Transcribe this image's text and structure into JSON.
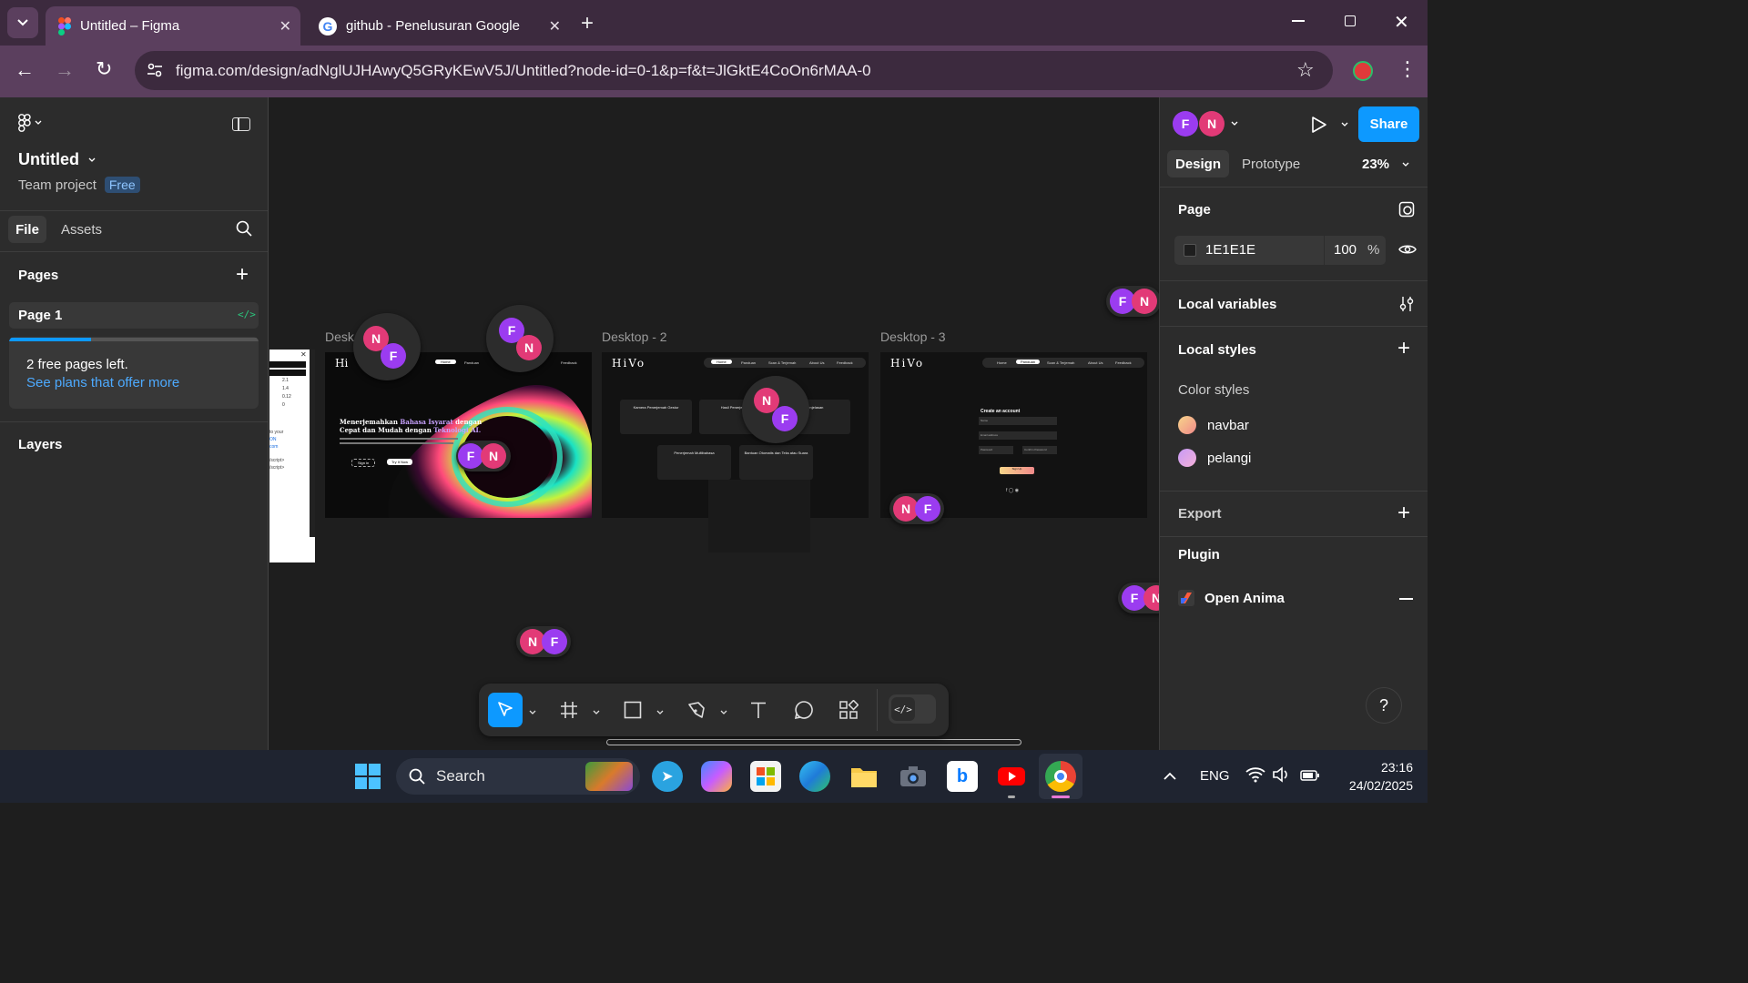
{
  "browser": {
    "tabs": [
      {
        "title": "Untitled – Figma",
        "active": true,
        "icon": "figma-logo-icon"
      },
      {
        "title": "github - Penelusuran Google",
        "active": false,
        "icon": "google-logo-icon"
      }
    ],
    "url": "figma.com/design/adNglUJHAwyQ5GRyKEwV5J/Untitled?node-id=0-1&p=f&t=JlGktE4CoOn6rMAA-0"
  },
  "left_panel": {
    "file_name": "Untitled",
    "project": "Team project",
    "plan_badge": "Free",
    "tabs": {
      "file": "File",
      "assets": "Assets"
    },
    "pages_title": "Pages",
    "current_page": "Page 1",
    "free_pages_notice": "2 free pages left.",
    "plans_link": "See plans that offer more",
    "free_pages_progress": 0.33,
    "layers_title": "Layers"
  },
  "canvas": {
    "frames": [
      {
        "label": "Desktop - 1",
        "label_visible": "Desk"
      },
      {
        "label": "Desktop - 2"
      },
      {
        "label": "Desktop - 3"
      }
    ],
    "frame1": {
      "logo": "Hi",
      "nav": [
        "Home",
        "Panduan",
        "Feedback"
      ],
      "headline_1": "Menerjemahkan",
      "headline_highlight": "Bahasa Isyarat",
      "headline_2": "dengan",
      "headline_3": "Cepat dan Mudah dengan",
      "headline_highlight_2": "Teknologi AI.",
      "btn_signin": "Sign in",
      "btn_tryit": "Try It Now"
    },
    "frame2": {
      "logo": "HiVo",
      "nav": [
        "Home",
        "Panduan",
        "Scan & Terjemah",
        "About Us",
        "Feedback"
      ],
      "cards": [
        "Kamera Penerjemah Gestur",
        "Hasil Penerjemah",
        "Penjelasan",
        "Penerjemah Multibahasa",
        "Bantuan Otomatis dan Teks atau Suara"
      ]
    },
    "frame3": {
      "logo": "HiVo",
      "nav": [
        "Home",
        "Panduan",
        "Scan & Terjemah",
        "About Us",
        "Feedback"
      ],
      "form_title": "Create an account",
      "fields": [
        "Name",
        "Email address",
        "Password",
        "Confirm Password"
      ],
      "btn": "Sign Up"
    },
    "partial_window": {
      "numbers": [
        "2.1",
        "1.4",
        "0.12",
        "0"
      ],
      "code_lines": [
        "to your",
        "ON",
        "com",
        "/script>",
        "/script>"
      ]
    }
  },
  "right_panel": {
    "tabs": {
      "design": "Design",
      "prototype": "Prototype"
    },
    "zoom": "23%",
    "share_label": "Share",
    "page_title": "Page",
    "page_color_hex": "1E1E1E",
    "page_opacity": "100",
    "percent_sign": "%",
    "local_variables": "Local variables",
    "local_styles": "Local styles",
    "color_styles_title": "Color styles",
    "color_styles": [
      {
        "name": "navbar",
        "colors": [
          "#f7d58a",
          "#f08a8a"
        ]
      },
      {
        "name": "pelangi",
        "colors": [
          "#c79af6",
          "#f5b1d9"
        ]
      }
    ],
    "export_title": "Export",
    "plugin_title": "Plugin",
    "plugin_name": "Open Anima",
    "help": "?"
  },
  "taskbar": {
    "search_placeholder": "Search",
    "language": "ENG",
    "time": "23:16",
    "date": "24/02/2025"
  },
  "collaborators": {
    "f": "F",
    "n": "N"
  },
  "colors": {
    "accent": "#0d99ff",
    "avatar_f": "#9b3cf0",
    "avatar_n": "#e23a77",
    "panel_bg": "#2c2c2c",
    "canvas_bg": "#1e1e1e"
  }
}
